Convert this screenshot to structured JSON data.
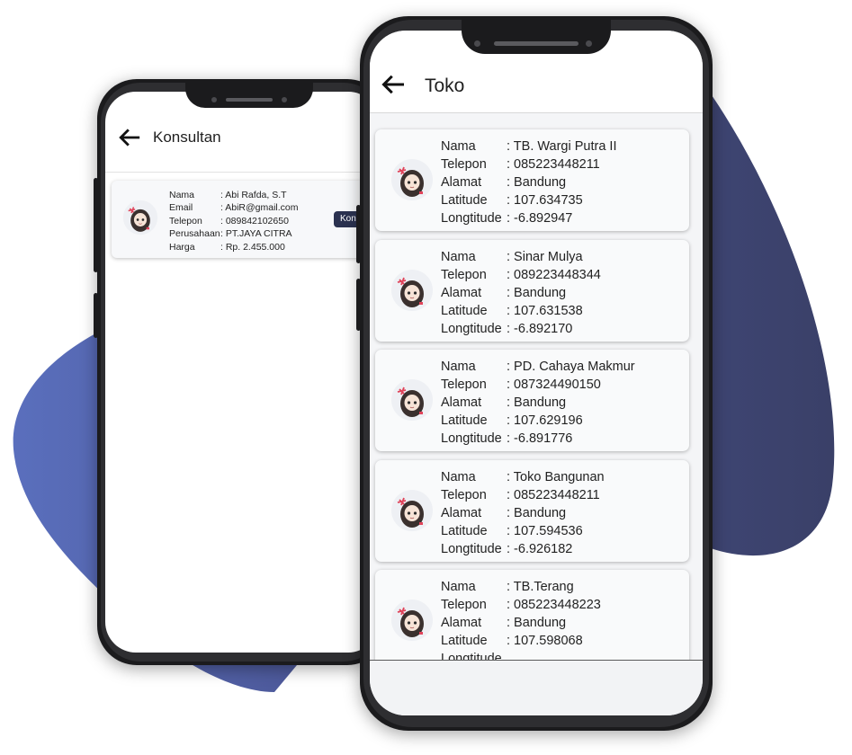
{
  "konsultan_screen": {
    "title": "Konsultan",
    "card": {
      "fields": [
        {
          "label": "Nama",
          "value": ": Abi Rafda, S.T"
        },
        {
          "label": "Email",
          "value": ": AbiR@gmail.com"
        },
        {
          "label": "Telepon",
          "value": ": 089842102650"
        },
        {
          "label": "Perusahaan",
          "value": ": PT.JAYA CITRA"
        },
        {
          "label": "Harga",
          "value": ": Rp. 2.455.000"
        }
      ],
      "contact_button": "Konta"
    }
  },
  "toko_screen": {
    "title": "Toko",
    "stores": [
      {
        "nama": ": TB. Wargi Putra II",
        "telepon": ": 085223448211",
        "alamat": ":  Bandung",
        "latitude": ": 107.634735",
        "longtitude": ": -6.892947"
      },
      {
        "nama": ": Sinar Mulya",
        "telepon": ": 089223448344",
        "alamat": ":  Bandung",
        "latitude": ": 107.631538",
        "longtitude": ": -6.892170"
      },
      {
        "nama": ": PD. Cahaya Makmur",
        "telepon": ": 087324490150",
        "alamat": ":  Bandung",
        "latitude": ": 107.629196",
        "longtitude": ": -6.891776"
      },
      {
        "nama": ": Toko Bangunan",
        "telepon": ": 085223448211",
        "alamat": ":  Bandung",
        "latitude": ": 107.594536",
        "longtitude": ": -6.926182"
      },
      {
        "nama": ": TB.Terang",
        "telepon": ": 085223448223",
        "alamat": ":  Bandung",
        "latitude": ": 107.598068",
        "longtitude": ""
      }
    ],
    "field_labels": {
      "nama": "Nama",
      "telepon": "Telepon",
      "alamat": "Alamat",
      "latitude": "Latitude",
      "longtitude": "Longtitude"
    }
  },
  "colors": {
    "blob_left": "#5a6fbd",
    "blob_right": "#3a4068",
    "button_bg": "#2b3250"
  },
  "icons": {
    "back": "arrow-left-icon",
    "avatar": "anime-girl-avatar"
  }
}
